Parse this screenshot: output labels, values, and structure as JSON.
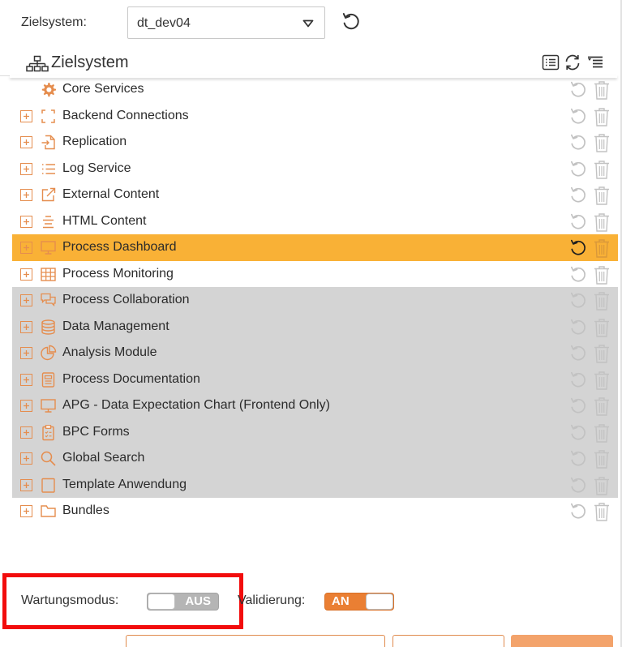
{
  "target_system": {
    "label": "Zielsystem:",
    "value": "dt_dev04"
  },
  "tree": {
    "title": "Zielsystem",
    "header_icons": [
      "list-view-icon",
      "refresh-icon",
      "sort-tree-icon"
    ],
    "items": [
      {
        "label": "Core Services",
        "icon": "gear-icon",
        "expandable": false,
        "state": "normal"
      },
      {
        "label": "Backend Connections",
        "icon": "bracket-frame-icon",
        "expandable": true,
        "state": "normal"
      },
      {
        "label": "Replication",
        "icon": "file-import-icon",
        "expandable": true,
        "state": "normal"
      },
      {
        "label": "Log Service",
        "icon": "list-icon",
        "expandable": true,
        "state": "normal"
      },
      {
        "label": "External Content",
        "icon": "external-link-icon",
        "expandable": true,
        "state": "normal"
      },
      {
        "label": "HTML Content",
        "icon": "text-align-center-icon",
        "expandable": true,
        "state": "normal"
      },
      {
        "label": "Process Dashboard",
        "icon": "monitor-icon",
        "expandable": true,
        "state": "selected"
      },
      {
        "label": "Process Monitoring",
        "icon": "table-icon",
        "expandable": true,
        "state": "normal"
      },
      {
        "label": "Process Collaboration",
        "icon": "chat-icon",
        "expandable": true,
        "state": "disabled"
      },
      {
        "label": "Data Management",
        "icon": "database-icon",
        "expandable": true,
        "state": "disabled"
      },
      {
        "label": "Analysis Module",
        "icon": "pie-chart-icon",
        "expandable": true,
        "state": "disabled"
      },
      {
        "label": "Process Documentation",
        "icon": "document-icon",
        "expandable": true,
        "state": "disabled"
      },
      {
        "label": "APG - Data Expectation Chart (Frontend Only)",
        "icon": "monitor-icon",
        "expandable": true,
        "state": "disabled"
      },
      {
        "label": "BPC Forms",
        "icon": "clipboard-icon",
        "expandable": true,
        "state": "disabled"
      },
      {
        "label": "Global Search",
        "icon": "search-icon",
        "expandable": true,
        "state": "disabled"
      },
      {
        "label": "Template Anwendung",
        "icon": "blank-page-icon",
        "expandable": true,
        "state": "disabled"
      },
      {
        "label": "Bundles",
        "icon": "folder-icon",
        "expandable": true,
        "state": "normal"
      }
    ]
  },
  "footer": {
    "maintenance_label": "Wartungsmodus:",
    "maintenance_toggle": "AUS",
    "validation_label": "Validierung:",
    "validation_toggle": "AN"
  },
  "colors": {
    "accent": "#ea7f33",
    "selected_row": "#f9b136",
    "disabled_row": "#d4d4d4",
    "highlight_frame": "#f20c0c"
  }
}
